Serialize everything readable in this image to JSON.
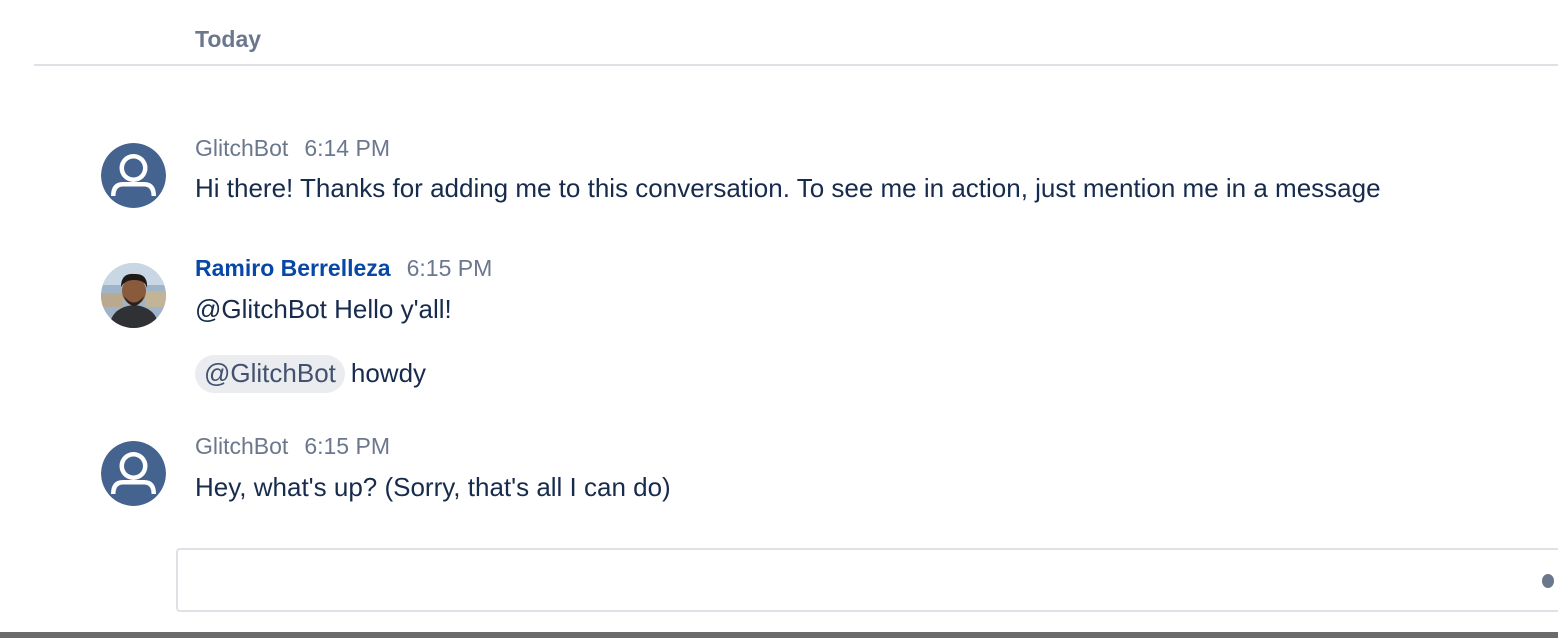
{
  "conversation": {
    "date_header": "Today",
    "messages": [
      {
        "author": "GlitchBot",
        "time": "6:14 PM",
        "avatar_icon": "default-user-avatar-icon",
        "lines": [
          "Hi there! Thanks for adding me to this conversation. To see me in action, just mention me in a message"
        ]
      },
      {
        "author": "Ramiro Berrelleza",
        "time": "6:15 PM",
        "avatar_icon": "user-photo-avatar",
        "lines": [
          "@GlitchBot Hello y'all!"
        ],
        "mention_line": {
          "mention": "@GlitchBot",
          "text": "howdy"
        }
      },
      {
        "author": "GlitchBot",
        "time": "6:15 PM",
        "avatar_icon": "default-user-avatar-icon",
        "lines": [
          "Hey, what's up? (Sorry, that's all I can do)"
        ]
      }
    ]
  },
  "composer": {
    "value": "",
    "placeholder": ""
  },
  "colors": {
    "muted_text": "#6b778c",
    "body_text": "#172b4d",
    "user_link": "#0747a6",
    "avatar_blue": "#44638f",
    "mention_bg": "#ebecf0",
    "divider": "#dfe1e6"
  }
}
